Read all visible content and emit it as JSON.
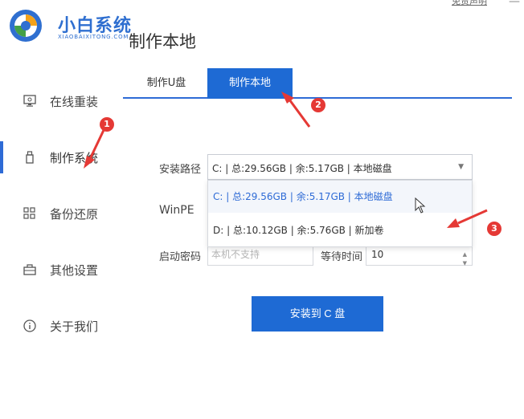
{
  "header": {
    "brand_name": "小白系统",
    "brand_sub": "XIAOBAIXITONG.COM",
    "page_title": "制作本地",
    "disclaimer": "免责声明",
    "close_glyph": "—"
  },
  "sidebar": {
    "items": [
      {
        "label": "在线重装",
        "icon": "monitor-icon"
      },
      {
        "label": "制作系统",
        "icon": "usb-icon",
        "active": true
      },
      {
        "label": "备份还原",
        "icon": "grid-icon"
      },
      {
        "label": "其他设置",
        "icon": "briefcase-icon"
      },
      {
        "label": "关于我们",
        "icon": "info-icon"
      }
    ]
  },
  "tabs": [
    {
      "label": "制作U盘",
      "active": false
    },
    {
      "label": "制作本地",
      "active": true
    }
  ],
  "form": {
    "install_path_label": "安装路径",
    "install_path_value": "C: | 总:29.56GB | 余:5.17GB | 本地磁盘",
    "winpe_label": "WinPE",
    "options": [
      "C: | 总:29.56GB | 余:5.17GB | 本地磁盘",
      "D: | 总:10.12GB | 余:5.76GB | 新加卷"
    ],
    "boot_password_label": "启动密码",
    "boot_password_placeholder": "本机不支持",
    "wait_time_label": "等待时间",
    "wait_time_value": "10"
  },
  "install_button": "安装到 C 盘",
  "annotations": [
    "1",
    "2",
    "3"
  ],
  "colors": {
    "accent": "#1e6ad4",
    "annotation": "#e53935",
    "brand": "#2f6fd0"
  }
}
